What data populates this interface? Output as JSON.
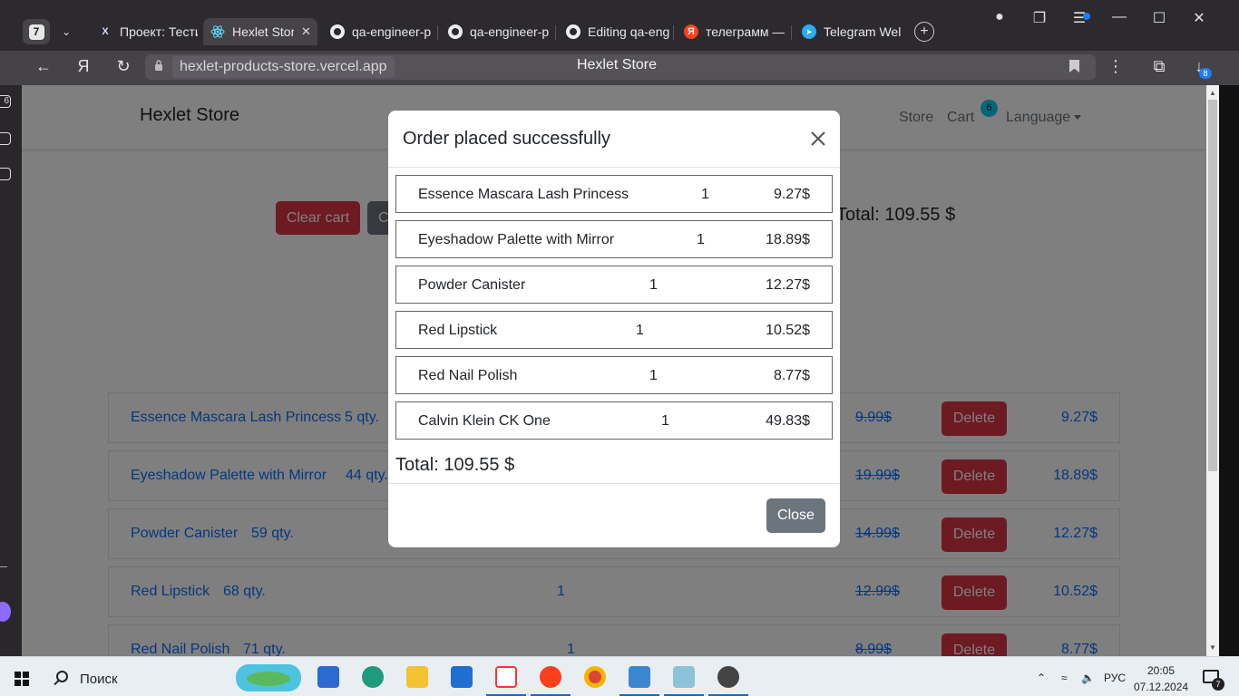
{
  "browser": {
    "tab_count": "7",
    "tabs": [
      {
        "label": "Проект: Тести",
        "favicon": "x-logo-icon",
        "active": false
      },
      {
        "label": "Hexlet Store",
        "favicon": "react-icon",
        "active": true
      },
      {
        "label": "qa-engineer-p",
        "favicon": "github-icon",
        "active": false
      },
      {
        "label": "qa-engineer-p",
        "favicon": "github-icon",
        "active": false
      },
      {
        "label": "Editing qa-eng",
        "favicon": "github-icon",
        "active": false
      },
      {
        "label": "телеграмм —",
        "favicon": "yandex-icon",
        "active": false
      },
      {
        "label": "Telegram Wel",
        "favicon": "telegram-icon",
        "active": false
      }
    ],
    "url_domain": "hexlet-products-store.vercel.app",
    "page_title": "Hexlet Store",
    "downloads_badge": "8"
  },
  "site": {
    "brand": "Hexlet Store",
    "nav": {
      "store": "Store",
      "cart": "Cart",
      "cart_count": "6",
      "language": "Language"
    },
    "clear_cart": "Clear cart",
    "checkout_partial": "C",
    "total": "Total: 109.55 $",
    "products": [
      {
        "name": "Essence Mascara Lash Princess",
        "stock": "5 qty.",
        "count": "",
        "old_price": "9.99$",
        "delete": "Delete",
        "price": "9.27$"
      },
      {
        "name": "Eyeshadow Palette with Mirror",
        "stock": "44 qty.",
        "count": "",
        "old_price": "19.99$",
        "delete": "Delete",
        "price": "18.89$"
      },
      {
        "name": "Powder Canister",
        "stock": "59 qty.",
        "count": "",
        "old_price": "14.99$",
        "delete": "Delete",
        "price": "12.27$"
      },
      {
        "name": "Red Lipstick",
        "stock": "68 qty.",
        "count": "1",
        "old_price": "12.99$",
        "delete": "Delete",
        "price": "10.52$"
      },
      {
        "name": "Red Nail Polish",
        "stock": "71 qty.",
        "count": "1",
        "old_price": "8.99$",
        "delete": "Delete",
        "price": "8.77$"
      }
    ]
  },
  "modal": {
    "title": "Order placed successfully",
    "items": [
      {
        "name": "Essence Mascara Lash Princess",
        "qty": "1",
        "price": "9.27$"
      },
      {
        "name": "Eyeshadow Palette with Mirror",
        "qty": "1",
        "price": "18.89$"
      },
      {
        "name": "Powder Canister",
        "qty": "1",
        "price": "12.27$"
      },
      {
        "name": "Red Lipstick",
        "qty": "1",
        "price": "10.52$"
      },
      {
        "name": "Red Nail Polish",
        "qty": "1",
        "price": "8.77$"
      },
      {
        "name": "Calvin Klein CK One",
        "qty": "1",
        "price": "49.83$"
      }
    ],
    "total": "Total: 109.55 $",
    "close": "Close"
  },
  "taskbar": {
    "search": "Поиск",
    "lang": "РУС",
    "time": "20:05",
    "date": "07.12.2024",
    "notifications": "7"
  },
  "colors": {
    "danger": "#dc3545",
    "secondary": "#6c757d",
    "link": "#0d6efd",
    "badge": "#0dcaf0"
  }
}
